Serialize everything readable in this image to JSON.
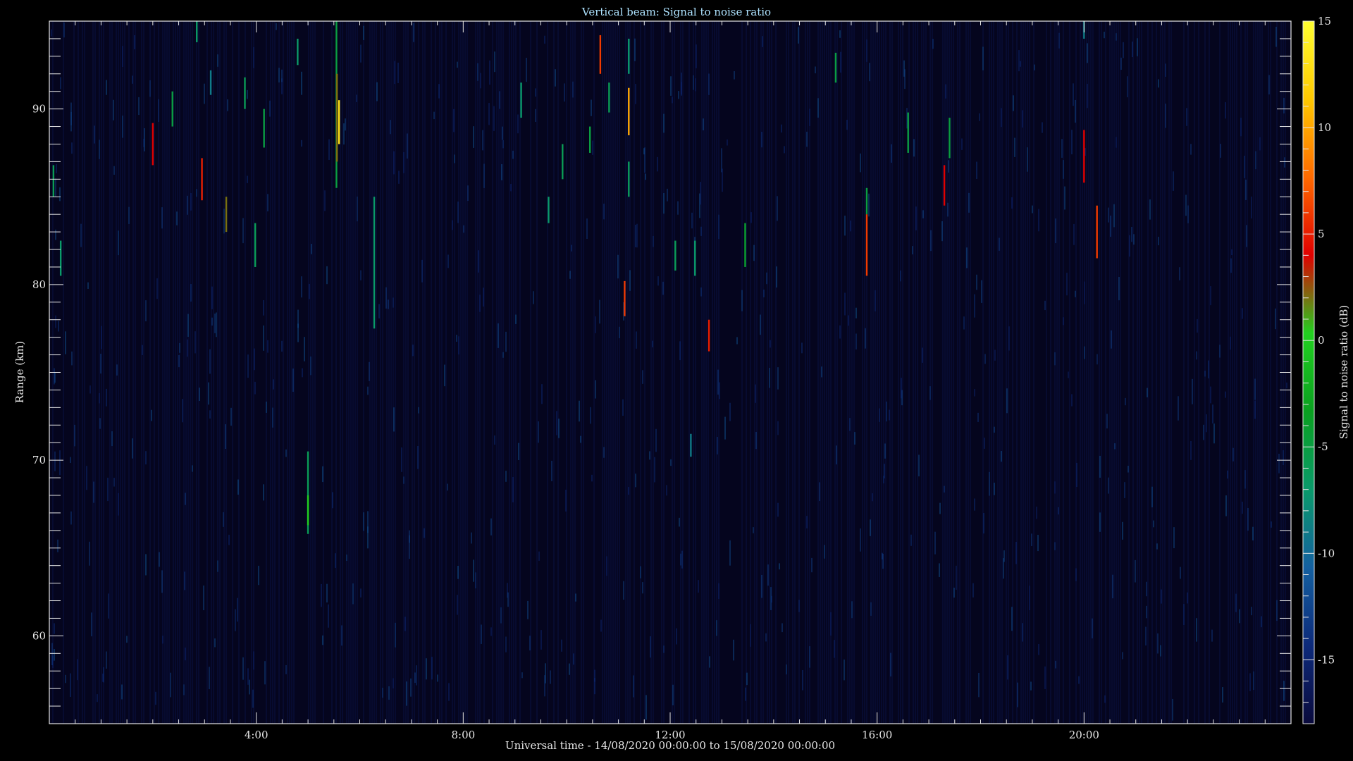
{
  "chart_data": {
    "type": "heatmap",
    "title": "Vertical beam: Signal to noise ratio",
    "xlabel": "Universal time - 14/08/2020 00:00:00 to 15/08/2020 00:00:00",
    "ylabel": "Range (km)",
    "colorbar_label": "Signal to noise ratio (dB)",
    "xlim_hours": [
      0,
      24
    ],
    "ylim_km": [
      55,
      95
    ],
    "clim_db": [
      -18,
      15
    ],
    "x_ticks": [
      {
        "hour": 4,
        "label": "4:00"
      },
      {
        "hour": 8,
        "label": "8:00"
      },
      {
        "hour": 12,
        "label": "12:00"
      },
      {
        "hour": 16,
        "label": "16:00"
      },
      {
        "hour": 20,
        "label": "20:00"
      }
    ],
    "y_ticks": [
      {
        "km": 60,
        "label": "60"
      },
      {
        "km": 70,
        "label": "70"
      },
      {
        "km": 80,
        "label": "80"
      },
      {
        "km": 90,
        "label": "90"
      }
    ],
    "colorbar_ticks": [
      {
        "db": 15,
        "label": "15"
      },
      {
        "db": 10,
        "label": "10"
      },
      {
        "db": 5,
        "label": "5"
      },
      {
        "db": 0,
        "label": "0"
      },
      {
        "db": -5,
        "label": "-5"
      },
      {
        "db": -10,
        "label": "-10"
      },
      {
        "db": -15,
        "label": "-15"
      }
    ],
    "colormap": [
      "#0a0a3c",
      "#0d2a7a",
      "#1460a0",
      "#0a9a6a",
      "#0aa020",
      "#22d020",
      "#e00000",
      "#ff6a00",
      "#ffc800",
      "#ffff30"
    ],
    "background_db": -16,
    "echoes": [
      {
        "t": 0.08,
        "r0": 85.0,
        "r1": 86.8,
        "db": -6
      },
      {
        "t": 0.22,
        "r0": 80.5,
        "r1": 82.5,
        "db": -7
      },
      {
        "t": 2.0,
        "r0": 86.8,
        "r1": 89.2,
        "db": 4
      },
      {
        "t": 2.38,
        "r0": 89.0,
        "r1": 91.0,
        "db": -5
      },
      {
        "t": 2.85,
        "r0": 93.8,
        "r1": 95.0,
        "db": -7
      },
      {
        "t": 2.95,
        "r0": 84.8,
        "r1": 87.2,
        "db": 5
      },
      {
        "t": 3.12,
        "r0": 90.8,
        "r1": 92.2,
        "db": -9
      },
      {
        "t": 3.42,
        "r0": 83.0,
        "r1": 85.0,
        "db": 2
      },
      {
        "t": 3.78,
        "r0": 90.0,
        "r1": 91.8,
        "db": -6
      },
      {
        "t": 3.98,
        "r0": 81.0,
        "r1": 83.5,
        "db": -6
      },
      {
        "t": 4.15,
        "r0": 87.8,
        "r1": 90.0,
        "db": -5
      },
      {
        "t": 4.8,
        "r0": 92.5,
        "r1": 94.0,
        "db": -7
      },
      {
        "t": 5.0,
        "r0": 65.8,
        "r1": 70.5,
        "db": -6
      },
      {
        "t": 5.0,
        "r0": 66.3,
        "r1": 68.0,
        "db": 0
      },
      {
        "t": 5.55,
        "r0": 85.5,
        "r1": 95.0,
        "db": -5
      },
      {
        "t": 5.56,
        "r0": 87.0,
        "r1": 92.0,
        "db": 2
      },
      {
        "t": 5.6,
        "r0": 88.0,
        "r1": 90.5,
        "db": 13
      },
      {
        "t": 6.28,
        "r0": 77.5,
        "r1": 85.0,
        "db": -7
      },
      {
        "t": 9.12,
        "r0": 89.5,
        "r1": 91.5,
        "db": -7
      },
      {
        "t": 9.65,
        "r0": 83.5,
        "r1": 85.0,
        "db": -7
      },
      {
        "t": 9.92,
        "r0": 86.0,
        "r1": 88.0,
        "db": -6
      },
      {
        "t": 10.45,
        "r0": 87.5,
        "r1": 89.0,
        "db": -5
      },
      {
        "t": 10.65,
        "r0": 92.0,
        "r1": 94.2,
        "db": 6
      },
      {
        "t": 10.82,
        "r0": 89.8,
        "r1": 91.5,
        "db": -6
      },
      {
        "t": 11.12,
        "r0": 78.2,
        "r1": 80.2,
        "db": 6
      },
      {
        "t": 11.2,
        "r0": 88.5,
        "r1": 91.2,
        "db": 10
      },
      {
        "t": 11.2,
        "r0": 85.0,
        "r1": 87.0,
        "db": -6
      },
      {
        "t": 11.2,
        "r0": 92.0,
        "r1": 94.0,
        "db": -7
      },
      {
        "t": 12.1,
        "r0": 80.8,
        "r1": 82.5,
        "db": -6
      },
      {
        "t": 12.4,
        "r0": 70.2,
        "r1": 71.5,
        "db": -9
      },
      {
        "t": 12.48,
        "r0": 80.5,
        "r1": 82.5,
        "db": -7
      },
      {
        "t": 12.75,
        "r0": 76.2,
        "r1": 78.0,
        "db": 5
      },
      {
        "t": 13.45,
        "r0": 81.0,
        "r1": 83.5,
        "db": -4
      },
      {
        "t": 15.2,
        "r0": 91.5,
        "r1": 93.2,
        "db": -5
      },
      {
        "t": 15.8,
        "r0": 80.5,
        "r1": 84.0,
        "db": 6
      },
      {
        "t": 15.8,
        "r0": 84.0,
        "r1": 85.5,
        "db": -5
      },
      {
        "t": 16.6,
        "r0": 87.5,
        "r1": 89.8,
        "db": -5
      },
      {
        "t": 17.3,
        "r0": 84.5,
        "r1": 86.8,
        "db": 4
      },
      {
        "t": 17.4,
        "r0": 87.2,
        "r1": 89.5,
        "db": -5
      },
      {
        "t": 20.0,
        "r0": 85.8,
        "r1": 88.8,
        "db": 4
      },
      {
        "t": 20.0,
        "r0": 94.0,
        "r1": 95.0,
        "db": -9
      },
      {
        "t": 20.25,
        "r0": 81.5,
        "r1": 84.5,
        "db": 6
      }
    ]
  }
}
